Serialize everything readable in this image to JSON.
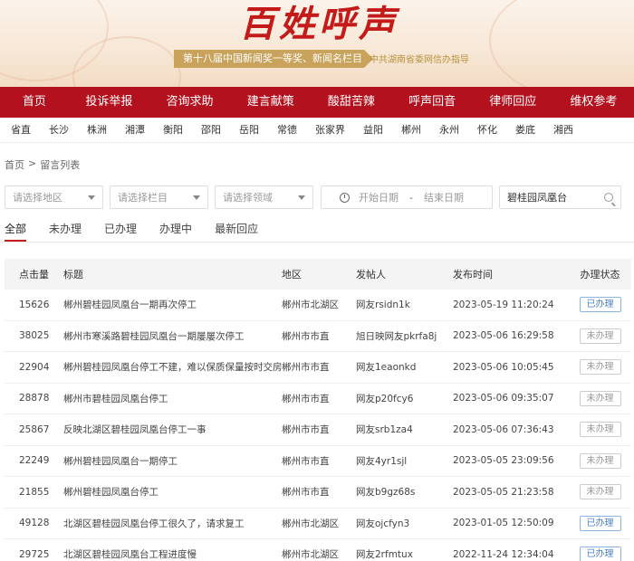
{
  "banner": {
    "title": "百姓呼声",
    "ribbon": "第十八届中国新闻奖一等奖、新闻名栏目",
    "guide": "中共湖南省委网信办指导"
  },
  "main_nav": [
    "首页",
    "投诉举报",
    "咨询求助",
    "建言献策",
    "酸甜苦辣",
    "呼声回音",
    "律师回应",
    "维权参考"
  ],
  "city_nav": [
    "省直",
    "长沙",
    "株洲",
    "湘潭",
    "衡阳",
    "邵阳",
    "岳阳",
    "常德",
    "张家界",
    "益阳",
    "郴州",
    "永州",
    "怀化",
    "娄底",
    "湘西"
  ],
  "breadcrumb": {
    "home": "首页",
    "sep": ">",
    "current": "留言列表"
  },
  "filters": {
    "region_placeholder": "请选择地区",
    "column_placeholder": "请选择栏目",
    "domain_placeholder": "请选择领域",
    "start_date_placeholder": "开始日期",
    "date_sep": "-",
    "end_date_placeholder": "结束日期",
    "search_value": "碧桂园凤凰台"
  },
  "tabs": [
    "全部",
    "未办理",
    "已办理",
    "办理中",
    "最新回应"
  ],
  "table": {
    "headers": [
      "点击量",
      "标题",
      "地区",
      "发帖人",
      "发布时间",
      "办理状态"
    ],
    "rows": [
      {
        "clicks": "15626",
        "title": "郴州碧桂园凤凰台一期再次停工",
        "region": "郴州市北湖区",
        "poster": "网友rsidn1k",
        "time": "2023-05-19 11:20:24",
        "status": "已办理",
        "done": true
      },
      {
        "clicks": "38025",
        "title": "郴州市寒溪路碧桂园凤凰台一期屡屡次停工",
        "region": "郴州市市直",
        "poster": "旭日映网友pkrfa8j",
        "time": "2023-05-06 16:29:58",
        "status": "未办理",
        "done": false
      },
      {
        "clicks": "22904",
        "title": "郴州碧桂园凤凰台停工不建，难以保质保量按时交房",
        "region": "郴州市市直",
        "poster": "网友1eaonkd",
        "time": "2023-05-06 10:05:45",
        "status": "未办理",
        "done": false
      },
      {
        "clicks": "28878",
        "title": "郴州市碧桂园凤凰台停工",
        "region": "郴州市市直",
        "poster": "网友p20fcy6",
        "time": "2023-05-06 09:35:07",
        "status": "未办理",
        "done": false
      },
      {
        "clicks": "25867",
        "title": "反映北湖区碧桂园凤凰台停工一事",
        "region": "郴州市市直",
        "poster": "网友srb1za4",
        "time": "2023-05-06 07:36:43",
        "status": "未办理",
        "done": false
      },
      {
        "clicks": "22249",
        "title": "郴州碧桂园凤凰台一期停工",
        "region": "郴州市市直",
        "poster": "网友4yr1sjl",
        "time": "2023-05-05 23:09:56",
        "status": "未办理",
        "done": false
      },
      {
        "clicks": "21855",
        "title": "郴州碧桂园凤凰台停工",
        "region": "郴州市市直",
        "poster": "网友b9gz68s",
        "time": "2023-05-05 21:23:58",
        "status": "未办理",
        "done": false
      },
      {
        "clicks": "49128",
        "title": "北湖区碧桂园凤凰台停工很久了，请求复工",
        "region": "郴州市北湖区",
        "poster": "网友ojcfyn3",
        "time": "2023-01-05 12:50:09",
        "status": "已办理",
        "done": true
      },
      {
        "clicks": "29725",
        "title": "北湖区碧桂园凤凰台工程进度慢",
        "region": "郴州市北湖区",
        "poster": "网友2rfmtux",
        "time": "2022-11-24 12:34:04",
        "status": "已办理",
        "done": true
      }
    ]
  },
  "colors": {
    "brand_red": "#b3111d",
    "title_red": "#c41a1a",
    "gold": "#c9a25c",
    "done_blue": "#4a7fbf"
  }
}
